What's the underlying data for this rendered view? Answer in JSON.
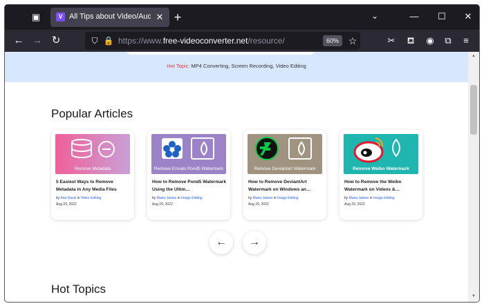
{
  "browser": {
    "tab_title": "All Tips about Video/Audio Con",
    "tab_favicon": "V",
    "url_protocol": "https://www.",
    "url_host": "free-videoconverter.net",
    "url_path": "/resource/",
    "zoom": "60%"
  },
  "icons": {
    "tab_list": "▣",
    "close": "✕",
    "new_tab": "+",
    "list_all": "⌄",
    "minimize": "—",
    "maximize": "☐",
    "window_close": "✕",
    "back": "←",
    "forward": "→",
    "reload": "↻",
    "shield": "⛉",
    "lock": "🔒",
    "bookmark": "☆",
    "screenshot": "✂",
    "pocket": "⛾",
    "account": "◉",
    "extensions": "⧉",
    "menu": "≡",
    "prev": "←",
    "next": "→",
    "scroll_up": "▲",
    "scroll_down": "▼"
  },
  "page": {
    "hot_topic_label": "Hot Topic:",
    "hot_topic_text": "MP4 Converting, Screen Recording, Video Editing",
    "popular_heading": "Popular Articles",
    "hot_heading": "Hot Topics",
    "by": "by",
    "in": "in",
    "articles": [
      {
        "caption": "Remove Metadata",
        "title": "5 Easiest Ways to Remove Metadata in Any Media Files",
        "author": "Arla Davis",
        "category": "Video Editing",
        "date": "Aug 29, 2022",
        "color": "#ee6aa0"
      },
      {
        "caption": "Remove Envato Pond5 Watermark",
        "title": "How to Remove Pond5 Watermark Using the Ultim…",
        "author": "Maria James",
        "category": "Image Editing",
        "date": "Aug 29, 2022",
        "color": "#9c83c7"
      },
      {
        "caption": "Remove Deviantart Watermark",
        "title": "How to Remove DeviantArt Watermark on Windows an…",
        "author": "Maria James",
        "category": "Image Editing",
        "date": "Aug 29, 2022",
        "color": "#a09380"
      },
      {
        "caption": "Remove Weibo Watermark",
        "title": "How to Remove the Weibo Watermark on Videos &…",
        "author": "Maria James",
        "category": "Image Editing",
        "date": "Aug 29, 2022",
        "color": "#1fb6b0"
      }
    ]
  }
}
